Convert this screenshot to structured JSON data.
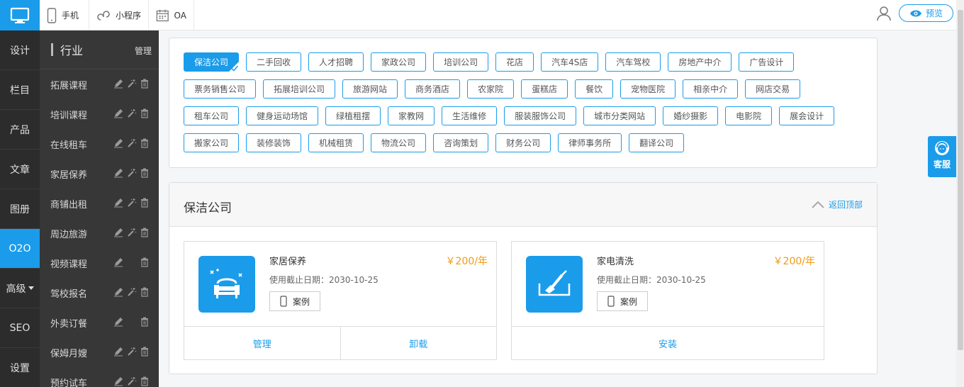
{
  "topbar": {
    "items": [
      {
        "label": "手机",
        "icon": "phone-icon"
      },
      {
        "label": "小程序",
        "icon": "miniapp-icon"
      },
      {
        "label": "OA",
        "icon": "calendar-icon"
      }
    ],
    "preview_label": "预览"
  },
  "leftnav": {
    "items": [
      "设计",
      "栏目",
      "产品",
      "文章",
      "图册",
      "O2O",
      "高级",
      "SEO",
      "设置"
    ],
    "active": "O2O"
  },
  "subnav": {
    "title": "行业",
    "manage_label": "管理",
    "items": [
      "拓展课程",
      "培训课程",
      "在线租车",
      "家居保养",
      "商铺出租",
      "周边旅游",
      "视频课程",
      "驾校报名",
      "外卖订餐",
      "保姆月嫂",
      "预约试车"
    ]
  },
  "tags": [
    "保洁公司",
    "二手回收",
    "人才招聘",
    "家政公司",
    "培训公司",
    "花店",
    "汽车4S店",
    "汽车驾校",
    "房地产中介",
    "广告设计",
    "票务销售公司",
    "拓展培训公司",
    "旅游网站",
    "商务酒店",
    "农家院",
    "蛋糕店",
    "餐饮",
    "宠物医院",
    "相亲中介",
    "网店交易",
    "租车公司",
    "健身运动场馆",
    "绿植租摆",
    "家教网",
    "生活维修",
    "服装服饰公司",
    "城市分类网站",
    "婚纱摄影",
    "电影院",
    "展会设计",
    "搬家公司",
    "装修装饰",
    "机械租赁",
    "物流公司",
    "咨询策划",
    "财务公司",
    "律师事务所",
    "翻译公司"
  ],
  "active_tag": "保洁公司",
  "detail": {
    "title": "保洁公司",
    "back_top": "返回顶部",
    "cards": [
      {
        "name": "家居保养",
        "price": "￥200/年",
        "date": "使用截止日期：2030-10-25",
        "case_label": "案例",
        "actions": [
          "管理",
          "卸载"
        ],
        "icon": "sofa-icon"
      },
      {
        "name": "家电清洗",
        "price": "￥200/年",
        "date": "使用截止日期：2030-10-25",
        "case_label": "案例",
        "actions": [
          "安装"
        ],
        "icon": "brush-icon"
      }
    ]
  },
  "kefu_label": "客服",
  "colors": {
    "accent": "#1a9cea",
    "price": "#f09a16",
    "nav_dark": "#2c2c2c",
    "subnav": "#373737"
  }
}
